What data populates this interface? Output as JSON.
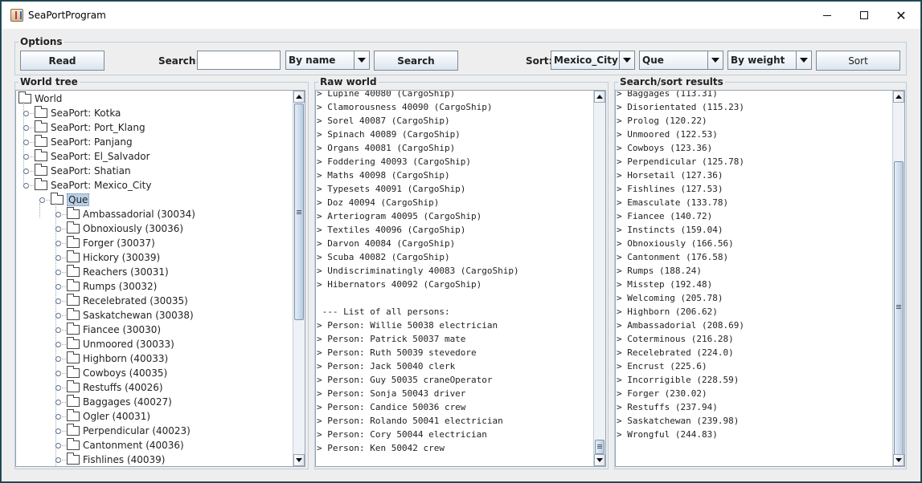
{
  "window": {
    "title": "SeaPortProgram"
  },
  "options": {
    "group_title": "Options",
    "read_label": "Read",
    "search_label": "Search:",
    "search_value": "",
    "search_by": "By name",
    "search_button": "Search",
    "sort_label": "Sort:",
    "sort_port": "Mexico_City",
    "sort_dock": "Que",
    "sort_by": "By weight",
    "sort_button": "Sort"
  },
  "world_tree": {
    "title": "World tree",
    "root": "World",
    "ports": [
      "SeaPort: Kotka",
      "SeaPort: Port_Klang",
      "SeaPort: Panjang",
      "SeaPort: El_Salvador",
      "SeaPort: Shatian",
      "SeaPort: Mexico_City"
    ],
    "dock": "Que",
    "ships": [
      "Ambassadorial (30034)",
      "Obnoxiously (30036)",
      "Forger (30037)",
      "Hickory (30039)",
      "Reachers (30031)",
      "Rumps (30032)",
      "Recelebrated (30035)",
      "Saskatchewan (30038)",
      "Fiancee (30030)",
      "Unmoored (30033)",
      "Highborn (40033)",
      "Cowboys (40035)",
      "Restuffs (40026)",
      "Baggages (40027)",
      "Ogler (40031)",
      "Perpendicular (40023)",
      "Cantonment (40036)",
      "Fishlines (40039)"
    ]
  },
  "raw_world": {
    "title": "Raw world",
    "lines": [
      "> Lupine 40080 (CargoShip)",
      "> Clamorousness 40090 (CargoShip)",
      "> Sorel 40087 (CargoShip)",
      "> Spinach 40089 (CargoShip)",
      "> Organs 40081 (CargoShip)",
      "> Foddering 40093 (CargoShip)",
      "> Maths 40098 (CargoShip)",
      "> Typesets 40091 (CargoShip)",
      "> Doz 40094 (CargoShip)",
      "> Arteriogram 40095 (CargoShip)",
      "> Textiles 40096 (CargoShip)",
      "> Darvon 40084 (CargoShip)",
      "> Scuba 40082 (CargoShip)",
      "> Undiscriminatingly 40083 (CargoShip)",
      "> Hibernators 40092 (CargoShip)",
      "",
      " --- List of all persons:",
      "> Person: Willie 50038 electrician",
      "> Person: Patrick 50037 mate",
      "> Person: Ruth 50039 stevedore",
      "> Person: Jack 50040 clerk",
      "> Person: Guy 50035 craneOperator",
      "> Person: Sonja 50043 driver",
      "> Person: Candice 50036 crew",
      "> Person: Rolando 50041 electrician",
      "> Person: Cory 50044 electrician",
      "> Person: Ken 50042 crew"
    ]
  },
  "results": {
    "title": "Search/sort results",
    "lines": [
      "> Baggages (113.31)",
      "> Disorientated (115.23)",
      "> Prolog (120.22)",
      "> Unmoored (122.53)",
      "> Cowboys (123.36)",
      "> Perpendicular (125.78)",
      "> Horsetail (127.36)",
      "> Fishlines (127.53)",
      "> Emasculate (133.78)",
      "> Fiancee (140.72)",
      "> Instincts (159.04)",
      "> Obnoxiously (166.56)",
      "> Cantonment (176.58)",
      "> Rumps (188.24)",
      "> Misstep (192.48)",
      "> Welcoming (205.78)",
      "> Highborn (206.62)",
      "> Ambassadorial (208.69)",
      "> Coterminous (216.28)",
      "> Recelebrated (224.0)",
      "> Encrust (225.6)",
      "> Incorrigible (228.59)",
      "> Forger (230.02)",
      "> Restuffs (237.94)",
      "> Saskatchewan (239.98)",
      "> Wrongful (244.83)"
    ]
  }
}
